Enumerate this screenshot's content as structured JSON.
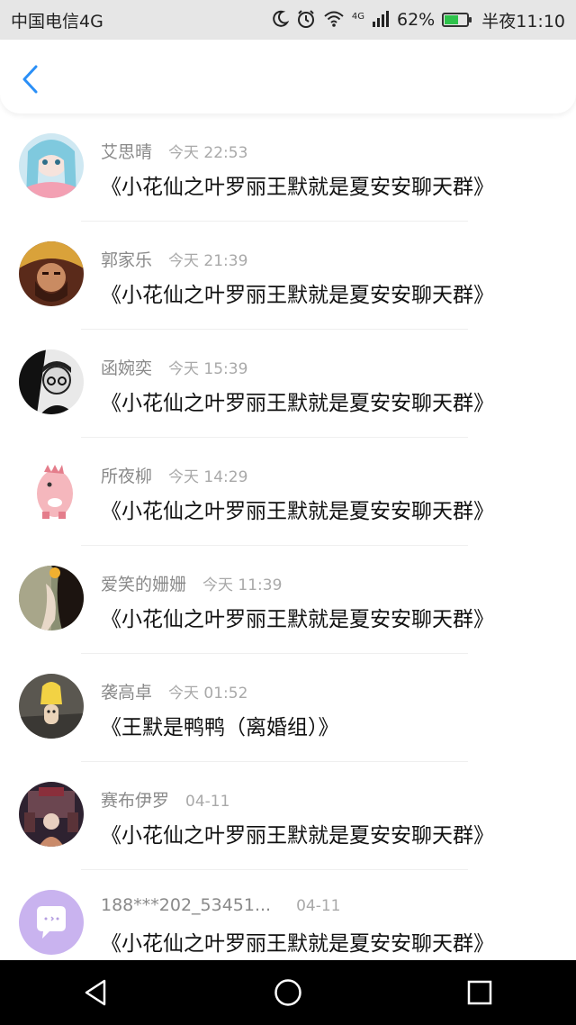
{
  "status_bar": {
    "carrier": "中国电信4G",
    "network_badge": "4G",
    "battery": "62%",
    "battery_level": 0.62,
    "time": "半夜11:10",
    "icons": [
      "moon-icon",
      "alarm-icon",
      "wifi-icon",
      "signal-icon",
      "battery-icon"
    ]
  },
  "nav": {
    "back_icon": "chevron-left-icon",
    "accent_color": "#2a8ff7"
  },
  "messages": [
    {
      "name": "艾思晴",
      "time": "今天 22:53",
      "text": "《小花仙之叶罗丽王默就是夏安安聊天群》"
    },
    {
      "name": "郭家乐",
      "time": "今天 21:39",
      "text": "《小花仙之叶罗丽王默就是夏安安聊天群》"
    },
    {
      "name": "函婉奕",
      "time": "今天 15:39",
      "text": "《小花仙之叶罗丽王默就是夏安安聊天群》"
    },
    {
      "name": "所夜柳",
      "time": "今天 14:29",
      "text": "《小花仙之叶罗丽王默就是夏安安聊天群》"
    },
    {
      "name": "爱笑的姗姗",
      "time": "今天 11:39",
      "text": "《小花仙之叶罗丽王默就是夏安安聊天群》"
    },
    {
      "name": "袭高卓",
      "time": "今天 01:52",
      "text": "《王默是鸭鸭（离婚组）》"
    },
    {
      "name": "赛布伊罗",
      "time": "04-11",
      "text": "《小花仙之叶罗丽王默就是夏安安聊天群》"
    },
    {
      "name": "188***202_53451...",
      "time": "04-11",
      "text": "《小花仙之叶罗丽王默就是夏安安聊天群》"
    }
  ],
  "bottom_nav": {
    "icons": [
      "back-triangle-icon",
      "home-circle-icon",
      "recents-square-icon"
    ]
  }
}
